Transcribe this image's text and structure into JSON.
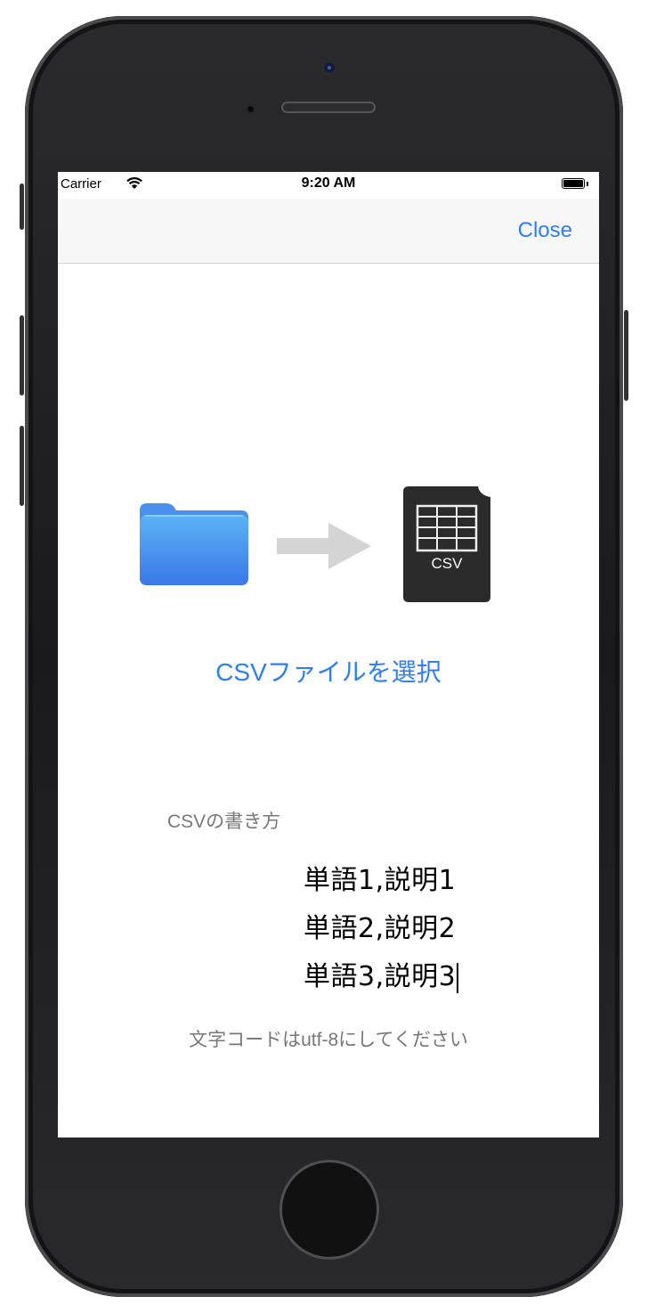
{
  "status_bar": {
    "carrier": "Carrier",
    "time": "9:20 AM"
  },
  "nav": {
    "close_label": "Close"
  },
  "illustration": {
    "csv_badge": "CSV"
  },
  "main": {
    "select_link": "CSVファイルを選択",
    "howto_title": "CSVの書き方",
    "examples": [
      "単語1,説明1",
      "単語2,説明2",
      "単語3,説明3"
    ],
    "encoding_note": "文字コードはutf-8にしてください"
  },
  "colors": {
    "accent": "#2f7ef2",
    "secondary_text": "#777777",
    "folder_top": "#5bb3f5",
    "folder_bottom": "#3a78e8",
    "csv_doc": "#2b2b2b"
  }
}
